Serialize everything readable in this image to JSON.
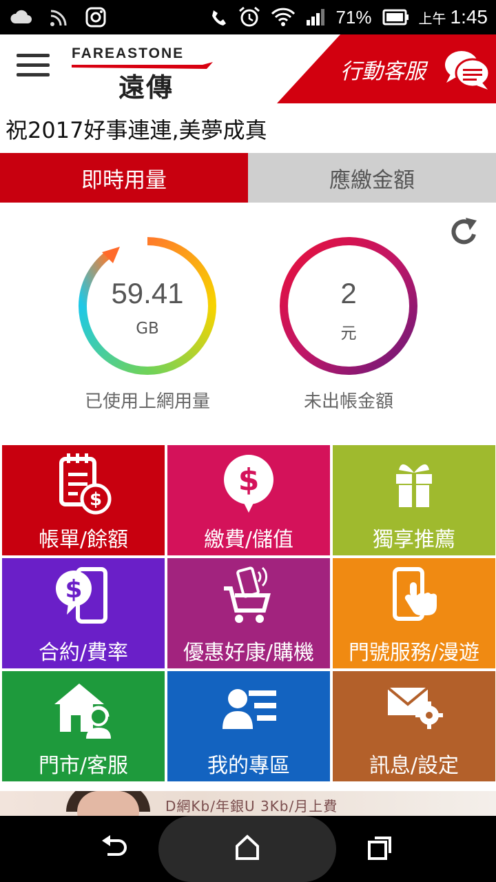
{
  "status_bar": {
    "battery_percent": "71%",
    "ampm": "上午",
    "time": "1:45",
    "icons": [
      "cloud-icon",
      "cast-icon",
      "instagram-icon",
      "vibrate-icon",
      "alarm-icon",
      "wifi-icon",
      "signal-icon",
      "battery-icon"
    ]
  },
  "header": {
    "logo_en": "FAREASTONE",
    "logo_zh": "遠傳",
    "customer_service": "行動客服",
    "brand_color": "#c8000f"
  },
  "greeting": "祝2017好事連連,美夢成真",
  "tabs": [
    {
      "label": "即時用量",
      "active": true
    },
    {
      "label": "應繳金額",
      "active": false
    }
  ],
  "usage": {
    "data": {
      "value": "59.41",
      "unit": "GB",
      "caption": "已使用上網用量"
    },
    "bill": {
      "value": "2",
      "unit": "元",
      "caption": "未出帳金額"
    }
  },
  "tiles": [
    {
      "label": "帳單/餘額",
      "icon": "bill-icon",
      "color": "#c8000f"
    },
    {
      "label": "繳費/儲值",
      "icon": "payment-icon",
      "color": "#d4125a"
    },
    {
      "label": "獨享推薦",
      "icon": "gift-icon",
      "color": "#9fba2e"
    },
    {
      "label": "合約/費率",
      "icon": "contract-icon",
      "color": "#6a1fc8"
    },
    {
      "label": "優惠好康/購機",
      "icon": "cart-icon",
      "color": "#a2237e"
    },
    {
      "label": "門號服務/漫遊",
      "icon": "phone-touch-icon",
      "color": "#f08a12"
    },
    {
      "label": "門市/客服",
      "icon": "store-icon",
      "color": "#1e9a3c"
    },
    {
      "label": "我的專區",
      "icon": "profile-icon",
      "color": "#1363c0"
    },
    {
      "label": "訊息/設定",
      "icon": "message-settings-icon",
      "color": "#b3602a"
    }
  ],
  "promo": {
    "text": "D網Kb/年銀U 3Kb/月上費"
  },
  "navbar": {
    "icons": [
      "back-icon",
      "home-icon",
      "recents-icon"
    ]
  }
}
